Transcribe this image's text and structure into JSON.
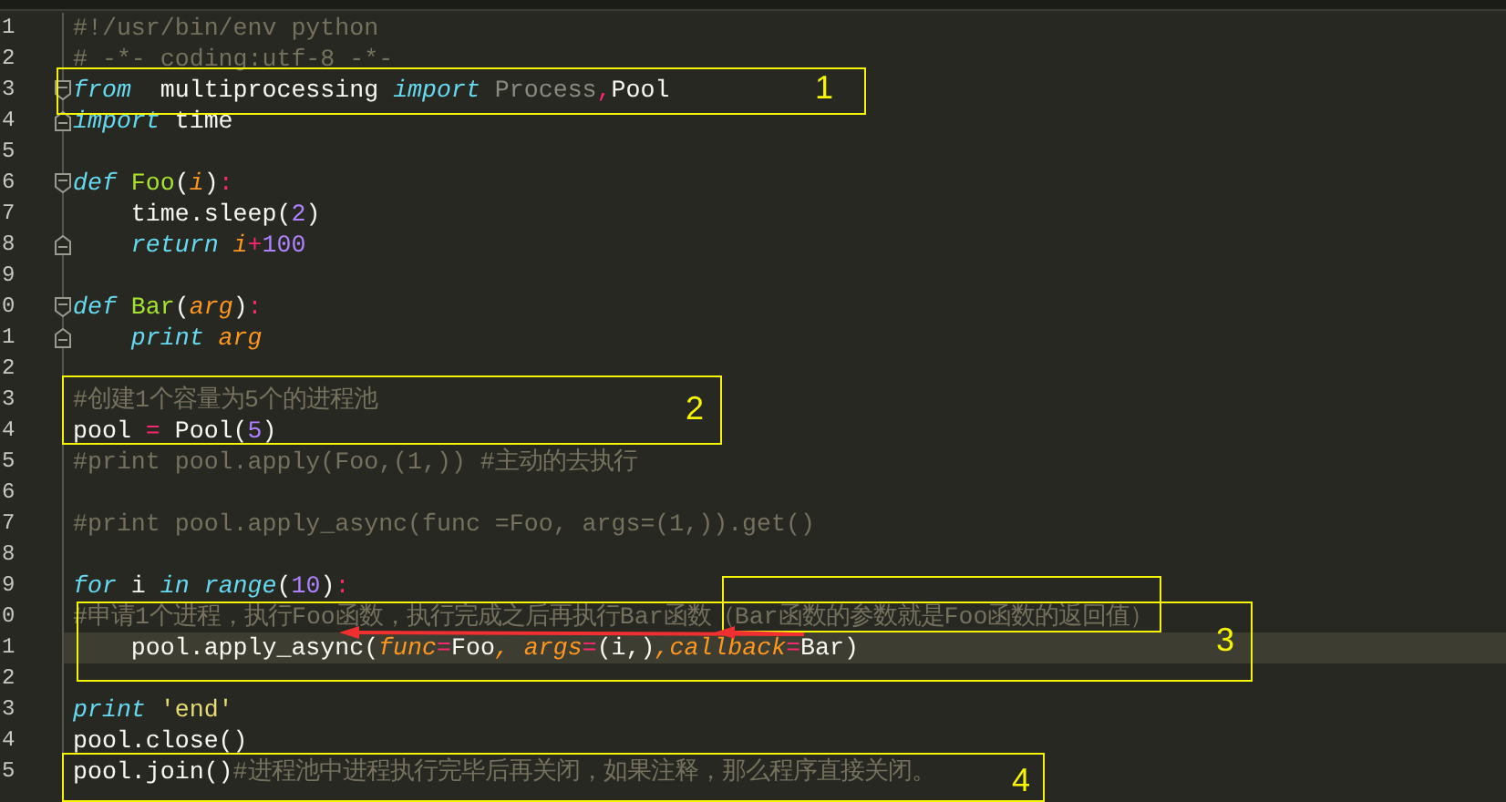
{
  "editor": {
    "lines": [
      {
        "number": "1",
        "current": false,
        "tokens": [
          {
            "kind": "comment",
            "text": "#!/usr/bin/env python"
          }
        ]
      },
      {
        "number": "2",
        "current": false,
        "tokens": [
          {
            "kind": "comment",
            "text": "# -*- coding:utf-8 -*-"
          }
        ]
      },
      {
        "number": "3",
        "current": false,
        "fold_start": true,
        "tokens": [
          {
            "kind": "keyword",
            "text": "from"
          },
          {
            "kind": "plain",
            "text": "  multiprocessing "
          },
          {
            "kind": "keyword",
            "text": "import"
          },
          {
            "kind": "dim",
            "text": " Process"
          },
          {
            "kind": "operator",
            "text": ","
          },
          {
            "kind": "plain",
            "text": "Pool"
          }
        ]
      },
      {
        "number": "4",
        "current": false,
        "fold_end": true,
        "tokens": [
          {
            "kind": "keyword",
            "text": "import"
          },
          {
            "kind": "plain",
            "text": " time"
          }
        ]
      },
      {
        "number": "5",
        "current": false
      },
      {
        "number": "6",
        "current": false,
        "fold_start": true,
        "tokens": [
          {
            "kind": "keyword",
            "text": "def "
          },
          {
            "kind": "function",
            "text": "Foo"
          },
          {
            "kind": "plain",
            "text": "("
          },
          {
            "kind": "param",
            "text": "i"
          },
          {
            "kind": "plain",
            "text": ")"
          },
          {
            "kind": "operator",
            "text": ":"
          }
        ]
      },
      {
        "number": "7",
        "current": false,
        "tokens": [
          {
            "kind": "plain",
            "text": "    time.sleep("
          },
          {
            "kind": "number",
            "text": "2"
          },
          {
            "kind": "plain",
            "text": ")"
          }
        ]
      },
      {
        "number": "8",
        "current": false,
        "fold_end": true,
        "tokens": [
          {
            "kind": "keyword",
            "text": "    return "
          },
          {
            "kind": "param",
            "text": "i"
          },
          {
            "kind": "operator",
            "text": "+"
          },
          {
            "kind": "number",
            "text": "100"
          }
        ]
      },
      {
        "number": "9",
        "current": false
      },
      {
        "number": "0",
        "current": false,
        "fold_start": true,
        "tokens": [
          {
            "kind": "keyword",
            "text": "def "
          },
          {
            "kind": "function",
            "text": "Bar"
          },
          {
            "kind": "plain",
            "text": "("
          },
          {
            "kind": "param",
            "text": "arg"
          },
          {
            "kind": "plain",
            "text": ")"
          },
          {
            "kind": "operator",
            "text": ":"
          }
        ]
      },
      {
        "number": "1",
        "current": false,
        "fold_end": true,
        "tokens": [
          {
            "kind": "keyword",
            "text": "    print "
          },
          {
            "kind": "param",
            "text": "arg"
          }
        ]
      },
      {
        "number": "2",
        "current": false
      },
      {
        "number": "3",
        "current": false,
        "tokens": [
          {
            "kind": "comment",
            "text": "#创建1个容量为5个的进程池"
          }
        ]
      },
      {
        "number": "4",
        "current": false,
        "tokens": [
          {
            "kind": "plain",
            "text": "pool "
          },
          {
            "kind": "operator",
            "text": "="
          },
          {
            "kind": "plain",
            "text": " Pool("
          },
          {
            "kind": "number",
            "text": "5"
          },
          {
            "kind": "plain",
            "text": ")"
          }
        ]
      },
      {
        "number": "5",
        "current": false,
        "tokens": [
          {
            "kind": "comment",
            "text": "#print pool.apply(Foo,(1,)) #主动的去执行"
          }
        ]
      },
      {
        "number": "6",
        "current": false
      },
      {
        "number": "7",
        "current": false,
        "tokens": [
          {
            "kind": "comment",
            "text": "#print pool.apply_async(func =Foo, args=(1,)).get()"
          }
        ]
      },
      {
        "number": "8",
        "current": false
      },
      {
        "number": "9",
        "current": false,
        "tokens": [
          {
            "kind": "keyword",
            "text": "for"
          },
          {
            "kind": "plain",
            "text": " i "
          },
          {
            "kind": "keyword",
            "text": "in range"
          },
          {
            "kind": "plain",
            "text": "("
          },
          {
            "kind": "number",
            "text": "10"
          },
          {
            "kind": "plain",
            "text": ")"
          },
          {
            "kind": "operator",
            "text": ":"
          }
        ]
      },
      {
        "number": "0",
        "current": false,
        "tokens": [
          {
            "kind": "comment",
            "text": "#申请1个进程，执行Foo函数，执行完成之后再执行Bar函数（Bar函数的参数就是Foo函数的返回值）"
          }
        ]
      },
      {
        "number": "1",
        "current": true,
        "tokens": [
          {
            "kind": "plain",
            "text": "    pool.apply_async("
          },
          {
            "kind": "param",
            "text": "func"
          },
          {
            "kind": "operator",
            "text": "="
          },
          {
            "kind": "plain",
            "text": "Foo"
          },
          {
            "kind": "param",
            "text": ", args"
          },
          {
            "kind": "operator",
            "text": "="
          },
          {
            "kind": "plain",
            "text": "(i,)"
          },
          {
            "kind": "param",
            "text": ",callback"
          },
          {
            "kind": "operator",
            "text": "="
          },
          {
            "kind": "plain",
            "text": "Bar)"
          }
        ]
      },
      {
        "number": "2",
        "current": false
      },
      {
        "number": "3",
        "current": false,
        "tokens": [
          {
            "kind": "keyword",
            "text": "print "
          },
          {
            "kind": "string",
            "text": "'end'"
          }
        ]
      },
      {
        "number": "4",
        "current": false,
        "tokens": [
          {
            "kind": "plain",
            "text": "pool.close()"
          }
        ]
      },
      {
        "number": "5",
        "current": false,
        "tokens": [
          {
            "kind": "plain",
            "text": "pool.join()"
          },
          {
            "kind": "comment",
            "text": "#进程池中进程执行完毕后再关闭，如果注释，那么程序直接关闭。"
          }
        ]
      }
    ]
  },
  "annotations": [
    {
      "label": "1"
    },
    {
      "label": "2"
    },
    {
      "label": "3"
    },
    {
      "label": "4"
    }
  ]
}
